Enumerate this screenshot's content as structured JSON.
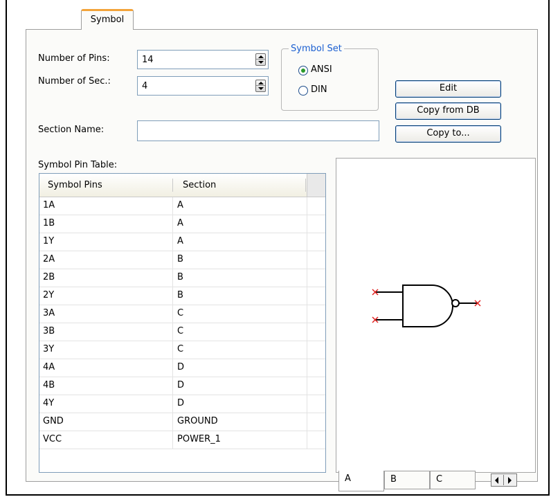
{
  "tab": {
    "label": "Symbol"
  },
  "pins": {
    "label": "Number of Pins:",
    "value": "14"
  },
  "sections": {
    "label": "Number of Sec.:",
    "value": "4"
  },
  "symbol_set": {
    "title": "Symbol Set",
    "options": [
      {
        "label": "ANSI",
        "selected": true
      },
      {
        "label": "DIN",
        "selected": false
      }
    ]
  },
  "buttons": {
    "edit": "Edit",
    "copy_from_db": "Copy from DB",
    "copy_to": "Copy to..."
  },
  "section_name": {
    "label": "Section Name:",
    "value": ""
  },
  "table": {
    "label": "Symbol Pin Table:",
    "headers": [
      "Symbol Pins",
      "Section"
    ],
    "rows": [
      {
        "pin": "1A",
        "section": "A"
      },
      {
        "pin": "1B",
        "section": "A"
      },
      {
        "pin": "1Y",
        "section": "A"
      },
      {
        "pin": "2A",
        "section": "B"
      },
      {
        "pin": "2B",
        "section": "B"
      },
      {
        "pin": "2Y",
        "section": "B"
      },
      {
        "pin": "3A",
        "section": "C"
      },
      {
        "pin": "3B",
        "section": "C"
      },
      {
        "pin": "3Y",
        "section": "C"
      },
      {
        "pin": "4A",
        "section": "D"
      },
      {
        "pin": "4B",
        "section": "D"
      },
      {
        "pin": "4Y",
        "section": "D"
      },
      {
        "pin": "GND",
        "section": "GROUND"
      },
      {
        "pin": "VCC",
        "section": "POWER_1"
      }
    ]
  },
  "preview": {
    "symbol_icon": "nand-gate-icon",
    "tabs": [
      "A",
      "B",
      "C"
    ],
    "active_tab": "A"
  },
  "colors": {
    "tab_accent": "#f3a33a",
    "group_title": "#1b5fd1",
    "pin_marker": "#e0201f",
    "radio_selected": "#2b9a2b"
  }
}
